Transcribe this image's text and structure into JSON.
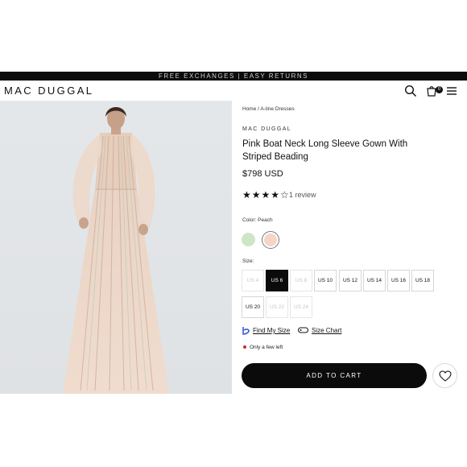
{
  "promo": {
    "text": "FREE EXCHANGES | EASY RETURNS"
  },
  "header": {
    "logo": "MAC DUGGAL",
    "cart_count": "0"
  },
  "breadcrumb": "Home / A-line Dresses",
  "product": {
    "brand": "MAC DUGGAL",
    "title": "Pink Boat Neck Long Sleeve Gown With Striped Beading",
    "price": "$798 USD",
    "rating": 4,
    "rating_max": 5,
    "stars": "★★★★☆",
    "review_text": "1 review"
  },
  "color": {
    "label": "Color: Peach",
    "swatches": [
      {
        "name": "mint",
        "hex": "#cfe6c6"
      },
      {
        "name": "peach",
        "hex": "#f6d5c6",
        "selected": true
      }
    ]
  },
  "size": {
    "label": "Size:",
    "options": [
      {
        "label": "US 4",
        "state": "off"
      },
      {
        "label": "US 6",
        "state": "sel"
      },
      {
        "label": "US 8",
        "state": "off"
      },
      {
        "label": "US 10",
        "state": "on"
      },
      {
        "label": "US 12",
        "state": "on"
      },
      {
        "label": "US 14",
        "state": "on"
      },
      {
        "label": "US 16",
        "state": "on"
      },
      {
        "label": "US 18",
        "state": "on"
      },
      {
        "label": "US 20",
        "state": "on"
      },
      {
        "label": "US 22",
        "state": "off"
      },
      {
        "label": "US 24",
        "state": "off"
      }
    ]
  },
  "links": {
    "find_my_size": "Find My Size",
    "size_chart": "Size Chart"
  },
  "availability": "Only a few left",
  "add_to_cart": "ADD TO CART",
  "colors": {
    "accent": "#0b0b0b",
    "low_stock": "#d12b2b",
    "photo_bg": "#e3e6e8"
  }
}
